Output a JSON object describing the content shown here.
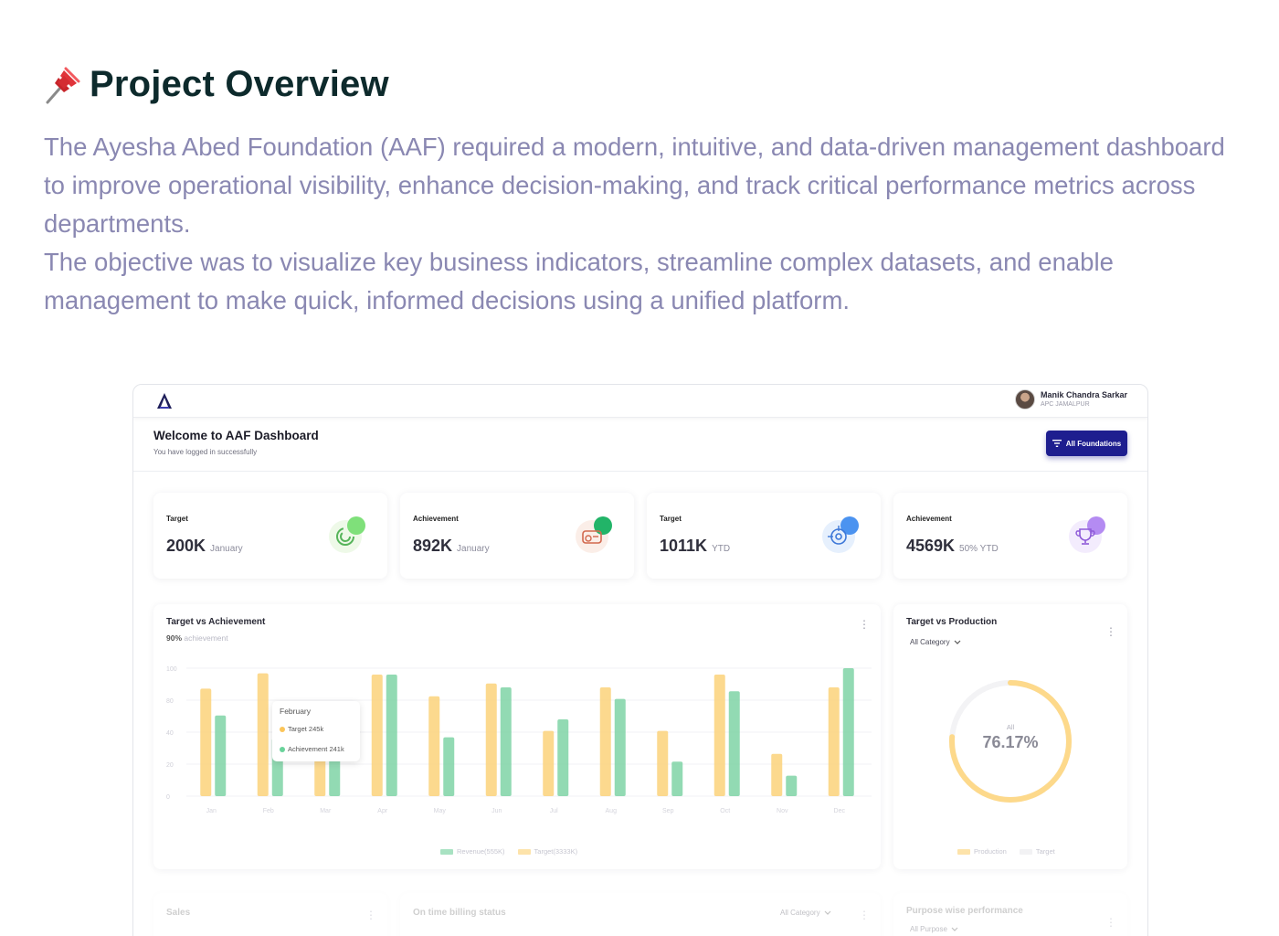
{
  "section": {
    "title": "Project Overview",
    "paragraphs": [
      "The Ayesha Abed Foundation (AAF) required a modern, intuitive, and data-driven management dashboard to improve operational visibility, enhance decision-making, and track critical performance metrics across departments.",
      "The objective was to visualize key business indicators, streamline complex datasets, and enable management to make quick, informed decisions using a unified platform."
    ]
  },
  "dashboard": {
    "user": {
      "name": "Manik Chandra Sarkar",
      "role": "APC JAMALPUR"
    },
    "welcome_title": "Welcome to AAF Dashboard",
    "welcome_subtitle": "You have logged in successfully",
    "filter_button": "All Foundations",
    "kpis": [
      {
        "label": "Target",
        "value": "200K",
        "period": "January",
        "icon": "progress-ring-icon",
        "accent": "#6fd36b"
      },
      {
        "label": "Achievement",
        "value": "892K",
        "period": "January",
        "icon": "cash-icon",
        "accent": "#1fb36a"
      },
      {
        "label": "Target",
        "value": "1011K",
        "period": "YTD",
        "icon": "target-icon",
        "accent": "#4b93f0"
      },
      {
        "label": "Achievement",
        "value": "4569K",
        "period": "50% YTD",
        "icon": "trophy-icon",
        "accent": "#b48bf2"
      }
    ],
    "bar_card": {
      "title": "Target vs Achievement",
      "sub_value": "90%",
      "sub_label": "achievement",
      "tooltip": {
        "month": "February",
        "target": "Target 245k",
        "achievement": "Achievement 241k"
      },
      "legend": [
        "Revenue(555K)",
        "Target(3333K)"
      ]
    },
    "donut_card": {
      "title": "Target vs Production",
      "dropdown": "All Category",
      "center_label": "All",
      "center_value": "76.17%",
      "legend": [
        "Production",
        "Target"
      ]
    },
    "bottom_cards": [
      {
        "title": "Sales"
      },
      {
        "title": "On time billing status",
        "dropdown": "All Category"
      },
      {
        "title": "Purpose wise performance",
        "dropdown": "All Purpose"
      }
    ]
  },
  "chart_data": {
    "type": "bar",
    "categories": [
      "Jan",
      "Feb",
      "Mar",
      "Apr",
      "May",
      "Jun",
      "Jul",
      "Aug",
      "Sep",
      "Oct",
      "Nov",
      "Dec"
    ],
    "y_ticks": [
      "100",
      "80",
      "40",
      "20",
      "0"
    ],
    "ylim": [
      0,
      100
    ],
    "series": [
      {
        "name": "Target",
        "color": "#fbd27a",
        "values": [
          84,
          96,
          35,
          95,
          78,
          88,
          51,
          85,
          51,
          95,
          33,
          85
        ]
      },
      {
        "name": "Achievement",
        "color": "#7fd4a6",
        "values": [
          63,
          45,
          34,
          95,
          46,
          85,
          60,
          76,
          27,
          82,
          16,
          100
        ]
      }
    ],
    "donut_percent": 76.17,
    "grid": true
  }
}
